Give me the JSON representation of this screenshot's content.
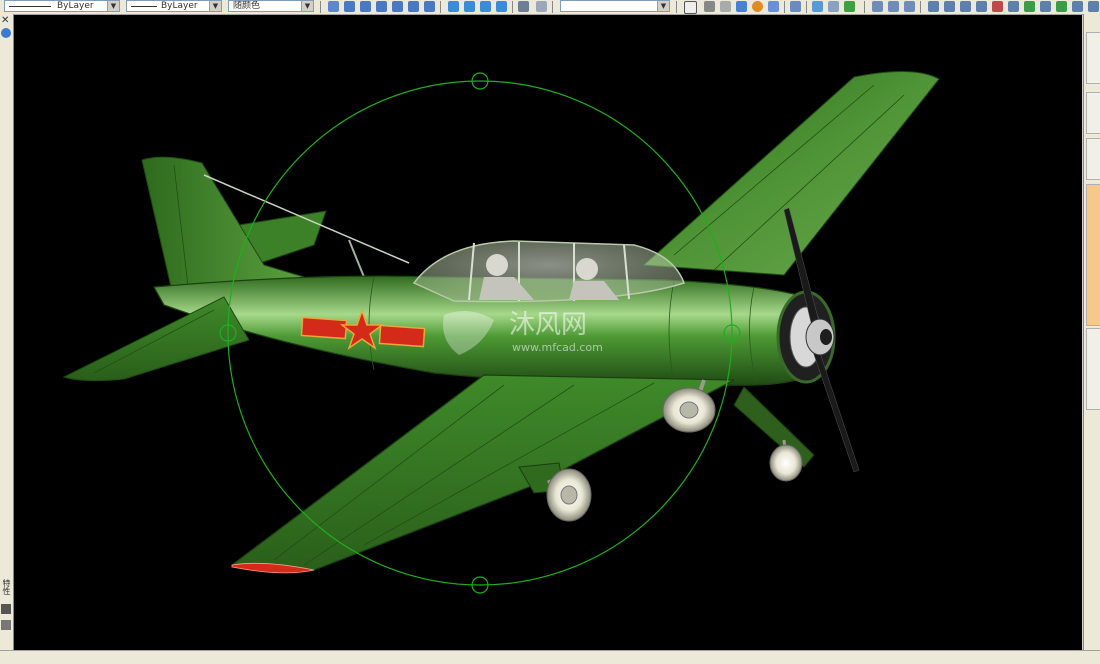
{
  "toolbar": {
    "linetype_value": "ByLayer",
    "lineweight_value": "ByLayer",
    "color_value": "随颜色"
  },
  "watermark": {
    "brand_cn": "沐风网",
    "brand_url": "www.mfcad.com"
  },
  "left_panel": {
    "label": "特性"
  },
  "colors": {
    "viewport_bg": "#000000",
    "orbit_circle": "#1fae1f",
    "airframe": "#3f8a2a",
    "emblem_red": "#d42a1a"
  }
}
